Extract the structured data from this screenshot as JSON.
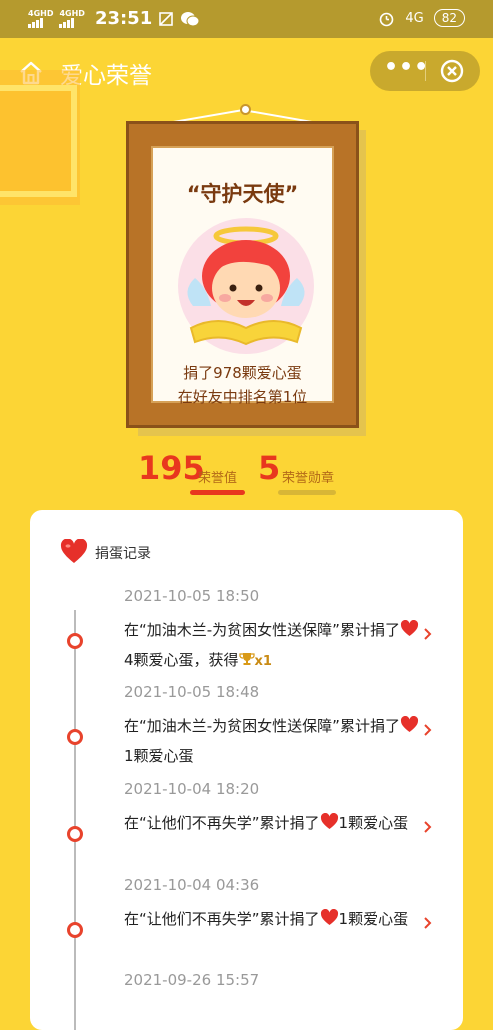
{
  "status_bar": {
    "network1": "4GHD",
    "network2": "4GHD",
    "time": "23:51",
    "network_right": "4G",
    "battery": "82"
  },
  "nav": {
    "title": "爱心荣誉",
    "more_label": "•••"
  },
  "frame": {
    "title": "“守护天使”",
    "line1": "捐了978颗爱心蛋",
    "line2": "在好友中排名第1位"
  },
  "stats": {
    "honor_value": "195",
    "honor_label": "荣誉值",
    "medal_value": "5",
    "medal_label": "荣誉勋章"
  },
  "records": {
    "title": "捐蛋记录",
    "items": [
      {
        "time": "2021-10-05 18:50",
        "before": "在“加油木兰-为贫困女性送保障”累计捐了",
        "after": "4颗爱心蛋，获得",
        "badge": "x1"
      },
      {
        "time": "2021-10-05 18:48",
        "before": "在“加油木兰-为贫困女性送保障”累计捐了",
        "after": "1颗爱心蛋"
      },
      {
        "time": "2021-10-04 18:20",
        "before": "在“让他们不再失学”累计捐了",
        "after": "1颗爱心蛋"
      },
      {
        "time": "2021-10-04 04:36",
        "before": "在“让他们不再失学”累计捐了",
        "after": "1颗爱心蛋"
      },
      {
        "time": "2021-09-26 15:57",
        "before": "",
        "after": ""
      }
    ]
  },
  "colors": {
    "background": "#fcd535",
    "accent_red": "#e8371e",
    "frame_wood": "#b87327"
  }
}
